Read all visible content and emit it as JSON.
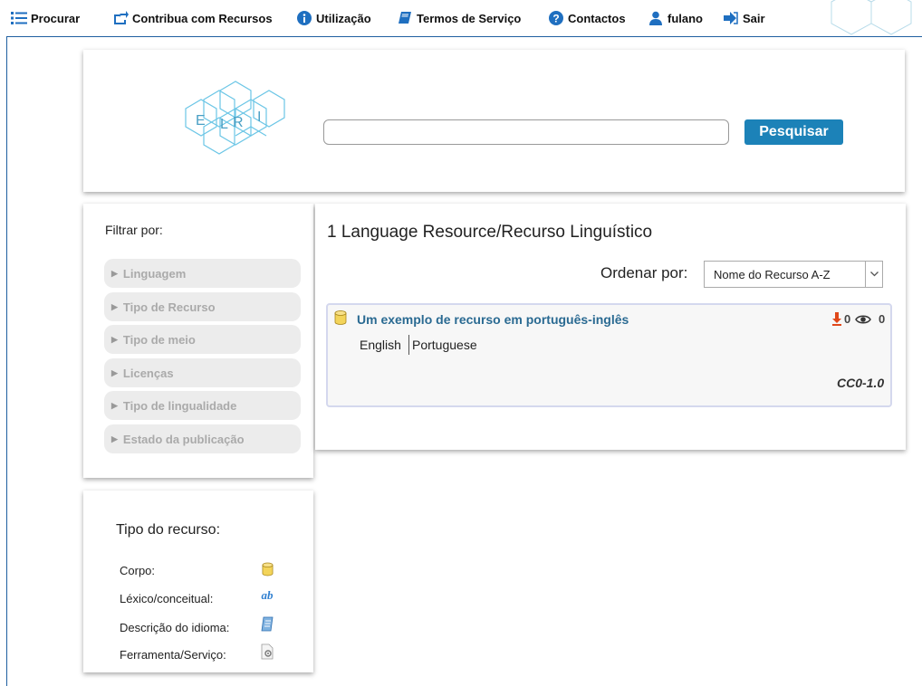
{
  "nav": {
    "items": [
      {
        "label": "Procurar",
        "icon": "list-icon"
      },
      {
        "label": "Contribua com Recursos",
        "icon": "share-icon"
      },
      {
        "label": "Utilização",
        "icon": "info-icon"
      },
      {
        "label": "Termos de Serviço",
        "icon": "book-icon"
      },
      {
        "label": "Contactos",
        "icon": "question-icon"
      },
      {
        "label": "fulano",
        "icon": "user-icon"
      },
      {
        "label": "Sair",
        "icon": "sign-out-icon"
      }
    ]
  },
  "header": {
    "logo_letters": [
      "E",
      "L",
      "R",
      "I"
    ],
    "search_value": "",
    "search_button": "Pesquisar"
  },
  "filters": {
    "title": "Filtrar por:",
    "items": [
      "Linguagem",
      "Tipo de Recurso",
      "Tipo de meio",
      "Licenças",
      "Tipo de lingualidade",
      "Estado da publicação"
    ]
  },
  "results": {
    "title": "1 Language Resource/Recurso Linguístico",
    "sort_label": "Ordenar por:",
    "sort_value": "Nome do Recurso A-Z",
    "items": [
      {
        "title": "Um exemplo de recurso em português-inglês",
        "languages": [
          "English",
          "Portuguese"
        ],
        "downloads": "0",
        "views": "0",
        "license": "CC0-1.0",
        "type_icon": "corpus-icon"
      }
    ]
  },
  "legend": {
    "title": "Tipo do recurso:",
    "items": [
      {
        "label": "Corpo:",
        "icon": "corpus-icon"
      },
      {
        "label": "Léxico/conceitual:",
        "icon": "lexical-icon",
        "icon_text": "ab"
      },
      {
        "label": "Descrição do idioma:",
        "icon": "language-description-icon"
      },
      {
        "label": "Ferramenta/Serviço:",
        "icon": "tool-service-icon"
      }
    ]
  },
  "colors": {
    "accent": "#1c82b8",
    "link": "#2a6a92",
    "nav_icon": "#1f6fc0",
    "logo": "#6cc6e6",
    "download": "#e0481a"
  }
}
